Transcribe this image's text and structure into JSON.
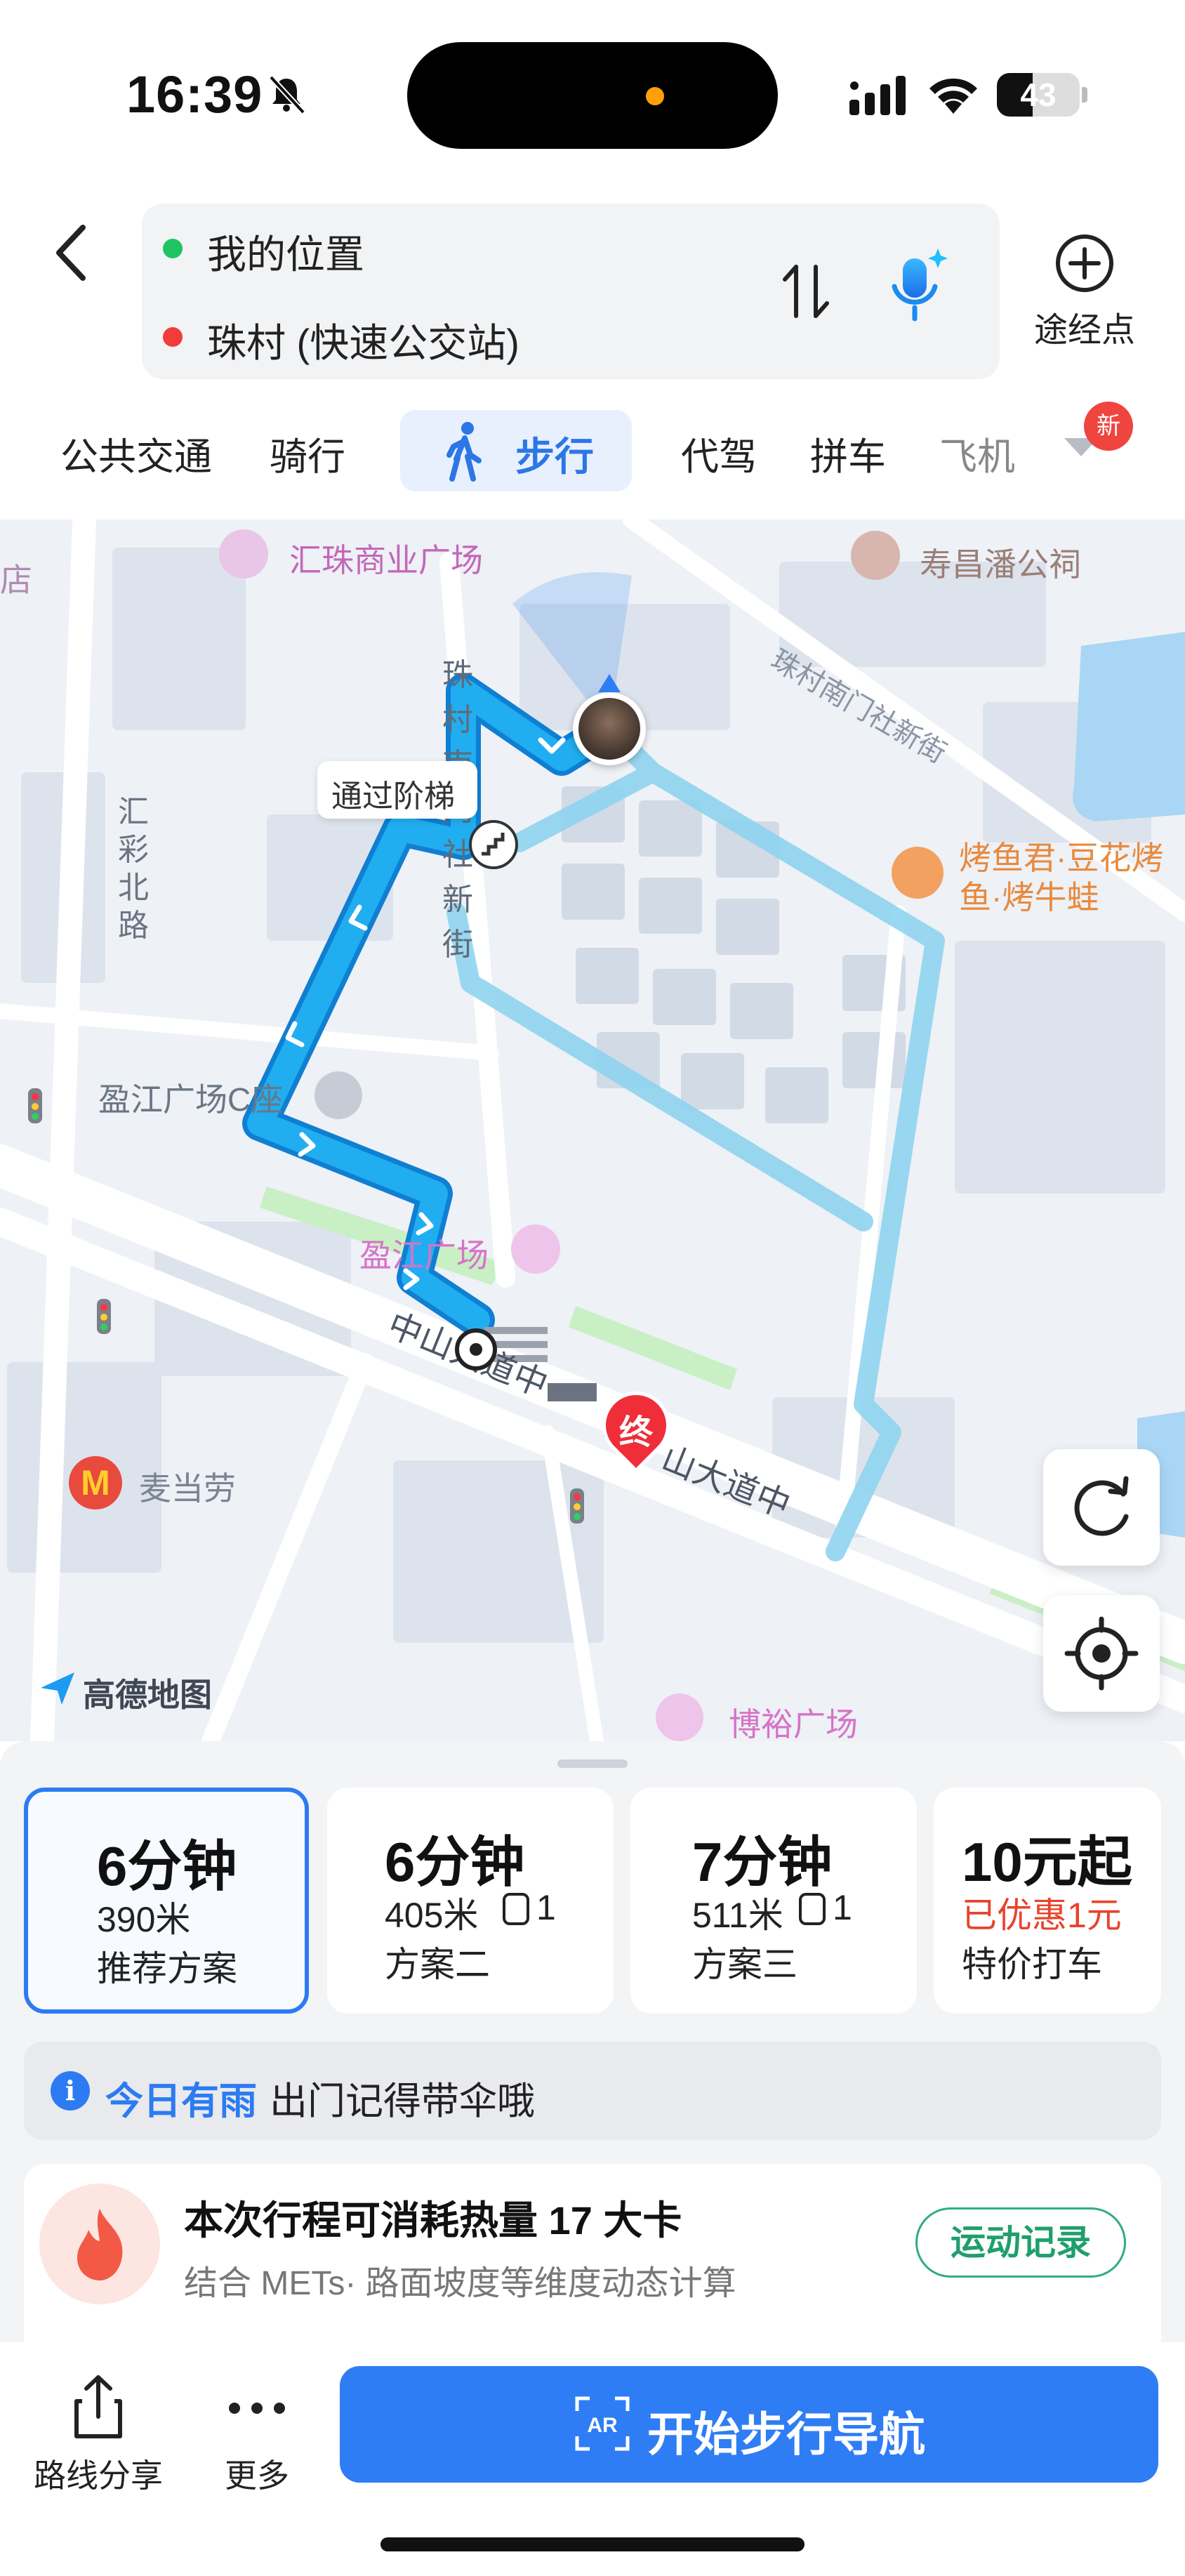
{
  "status_bar": {
    "time": "16:39",
    "battery": "43",
    "battery_level": 0.43
  },
  "route": {
    "from": "我的位置",
    "to": "珠村 (快速公交站)",
    "waypoint_label": "途经点"
  },
  "modes": {
    "items": [
      "公共交通",
      "骑行",
      "步行",
      "代驾",
      "拼车",
      "飞机"
    ],
    "selected": "步行",
    "badge": "新"
  },
  "map": {
    "labels": {
      "huizhu": "汇珠商业广场",
      "shouchang": "寿昌潘公祠",
      "zhucun_nanmen_she": "珠村南门社新街",
      "zhucun_nanmen_xin": "珠村南门社新街",
      "huicai": "汇彩北路",
      "kaoyujun": "烤鱼君·豆花烤鱼·烤牛蛙",
      "yingjiang_c": "盈江广场C座",
      "yingjiang": "盈江广场",
      "zhongshan_1": "中山大道中",
      "zhongshan_2": "山大道中",
      "mcd": "麦当劳",
      "boyu": "博裕广场",
      "brand": "高德地图",
      "stairs_tip": "通过阶梯",
      "end_marker": "终",
      "edge_left": "店"
    }
  },
  "plans": [
    {
      "time": "6分钟",
      "distance": "390米",
      "name": "推荐方案",
      "lights": ""
    },
    {
      "time": "6分钟",
      "distance": "405米",
      "name": "方案二",
      "lights": "1"
    },
    {
      "time": "7分钟",
      "distance": "511米",
      "name": "方案三",
      "lights": "1"
    },
    {
      "time": "10元起",
      "distance": "已优惠1元",
      "name": "特价打车",
      "lights": ""
    }
  ],
  "notice": {
    "highlight": "今日有雨",
    "text": "出门记得带伞哦"
  },
  "calories": {
    "title": "本次行程可消耗热量 17 大卡",
    "subtitle": "结合 METs· 路面坡度等维度动态计算",
    "button": "运动记录"
  },
  "bottom": {
    "share_label": "路线分享",
    "more_label": "更多",
    "nav_label": "开始步行导航"
  },
  "colors": {
    "accent": "#2f7df4",
    "route_primary": "#1aa6ea",
    "route_alt": "#9fdcf0",
    "discount": "#e8432d",
    "record_green": "#1f9e6e"
  }
}
